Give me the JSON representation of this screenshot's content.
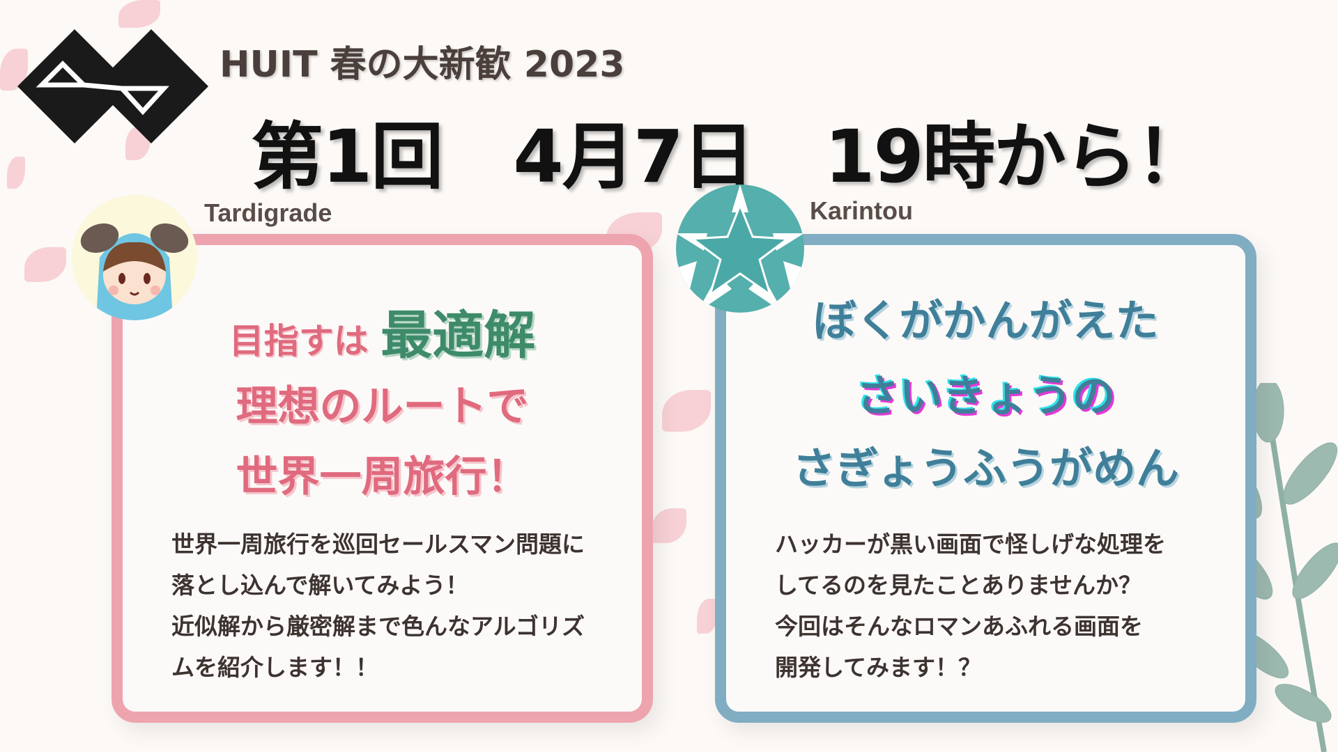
{
  "header": {
    "subtitle": "HUIT 春の大新歓 2023",
    "title": "第1回　4月7日　19時から！",
    "logo": "huit-logo"
  },
  "cards": [
    {
      "speaker": "Tardigrade",
      "avatar": "girl-in-blue-hood-avatar",
      "heading": {
        "line1_prefix": "目指すは",
        "line1_emph": "最適解",
        "line2": "理想のルートで",
        "line3": "世界一周旅行！"
      },
      "body": [
        "世界一周旅行を巡回セールスマン問題に",
        "落とし込んで解いてみよう！",
        "近似解から厳密解まで色んなアルゴリズ",
        "ムを紹介します！！"
      ],
      "colors": {
        "border": "#eea4ae",
        "heading": "#e06a7e",
        "emph": "#3e8b6a"
      }
    },
    {
      "speaker": "Karintou",
      "avatar": "teal-star-avatar",
      "heading": {
        "line1": "ぼくがかんがえた",
        "line2": "さいきょうの",
        "line3": "さぎょうふうがめん"
      },
      "body": [
        "ハッカーが黒い画面で怪しげな処理を",
        "してるのを見たことありませんか？",
        "今回はそんなロマンあふれる画面を",
        "開発してみます！？"
      ],
      "colors": {
        "border": "#80adc2",
        "heading": "#3f7f99"
      }
    }
  ]
}
